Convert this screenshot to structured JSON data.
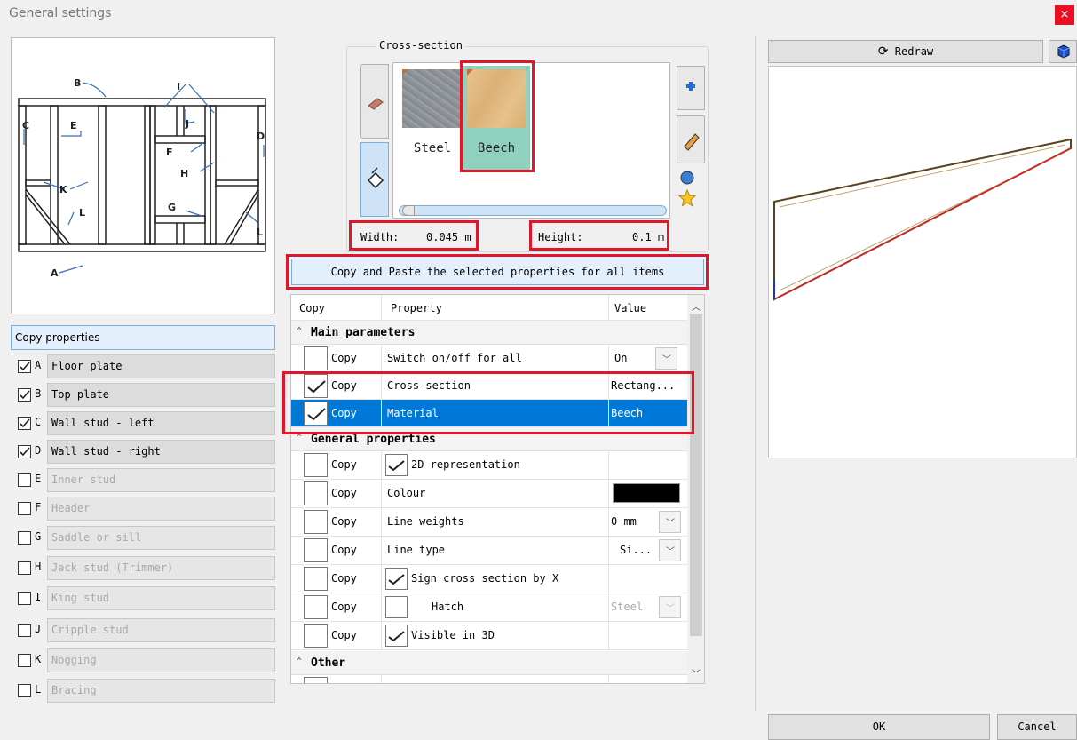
{
  "window": {
    "title": "General settings",
    "close_glyph": "×"
  },
  "diagram_labels": [
    "A",
    "B",
    "C",
    "D",
    "E",
    "F",
    "G",
    "H",
    "I",
    "J",
    "K",
    "L",
    "L"
  ],
  "left": {
    "copy_properties_label": "Copy properties",
    "elements": [
      {
        "letter": "A",
        "label": "Floor plate",
        "checked": true
      },
      {
        "letter": "B",
        "label": "Top plate",
        "checked": true
      },
      {
        "letter": "C",
        "label": "Wall stud - left",
        "checked": true
      },
      {
        "letter": "D",
        "label": "Wall stud - right",
        "checked": true
      },
      {
        "letter": "E",
        "label": "Inner stud",
        "checked": false
      },
      {
        "letter": "F",
        "label": "Header",
        "checked": false
      },
      {
        "letter": "G",
        "label": "Saddle or sill",
        "checked": false
      },
      {
        "letter": "H",
        "label": "Jack stud (Trimmer)",
        "checked": false
      },
      {
        "letter": "I",
        "label": "King stud",
        "checked": false
      },
      {
        "letter": "J",
        "label": "Cripple stud",
        "checked": false
      },
      {
        "letter": "K",
        "label": "Nogging",
        "checked": false
      },
      {
        "letter": "L",
        "label": "Bracing",
        "checked": false
      }
    ]
  },
  "cross_section": {
    "group_label": "Cross-section",
    "materials": [
      {
        "name": "Steel",
        "color": "#8e9398"
      },
      {
        "name": "Beech",
        "color": "#e2bc84"
      }
    ],
    "width_label": "Width:",
    "width_value": "0.045 m",
    "height_label": "Height:",
    "height_value": "0.1 m"
  },
  "copy_paste_label": "Copy and Paste the selected properties for all items",
  "grid": {
    "headers": [
      "Copy",
      "Property",
      "Value"
    ],
    "sections": {
      "main": "Main parameters",
      "general": "General properties",
      "other": "Other"
    },
    "main_rows": [
      {
        "copy": "Copy",
        "property": "Switch on/off for all",
        "value": "On"
      },
      {
        "copy": "Copy",
        "property": "Cross-section",
        "value": "Rectang..."
      },
      {
        "copy": "Copy",
        "property": "Material",
        "value": "Beech"
      }
    ],
    "general_rows": [
      {
        "copy": "Copy",
        "property": "2D representation",
        "value": ""
      },
      {
        "copy": "Copy",
        "property": "Colour",
        "value": ""
      },
      {
        "copy": "Copy",
        "property": "Line weights",
        "value": "0 mm"
      },
      {
        "copy": "Copy",
        "property": "Line type",
        "value": "Si..."
      },
      {
        "copy": "Copy",
        "property": "Sign cross section by X",
        "value": ""
      },
      {
        "copy": "Copy",
        "property": "Hatch",
        "value": "Steel"
      },
      {
        "copy": "Copy",
        "property": "Visible in 3D",
        "value": ""
      }
    ]
  },
  "right": {
    "redraw_label": "Redraw"
  },
  "footer": {
    "ok_label": "OK",
    "cancel_label": "Cancel"
  },
  "colors": {
    "accent": "#0078d7",
    "highlight": "#e0162b",
    "colour_swatch": "#000000"
  }
}
